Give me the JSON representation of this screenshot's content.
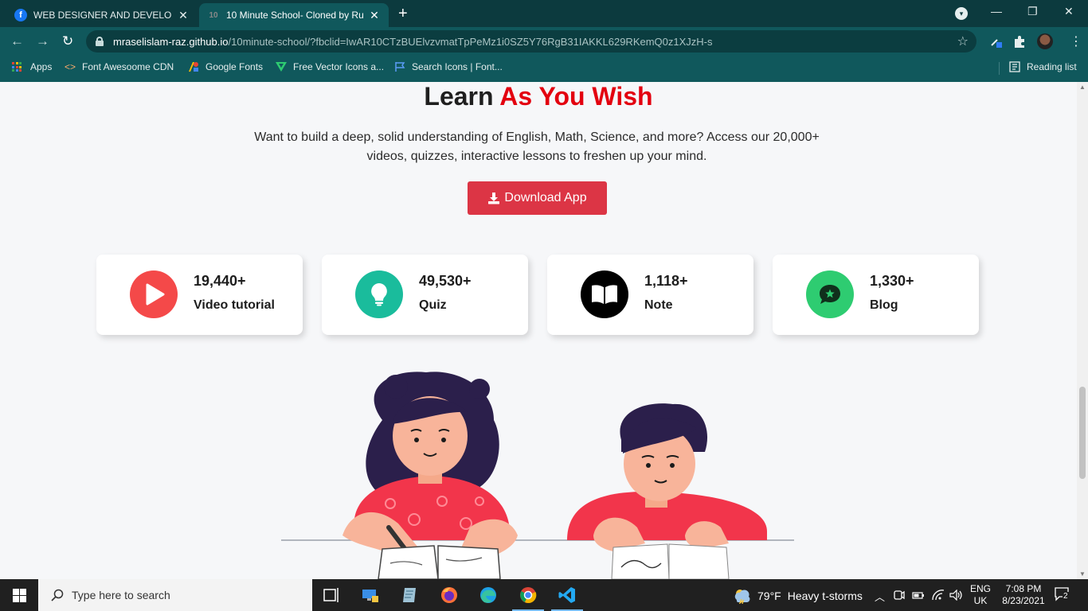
{
  "browser": {
    "tabs": [
      {
        "title": "WEB DESIGNER AND DEVELOPER",
        "favicon": "facebook-icon"
      },
      {
        "title": "10 Minute School- Cloned by Ru",
        "favicon": "10ms-icon"
      }
    ],
    "new_tab": "+",
    "address": {
      "host": "mraselislam-raz.github.io",
      "path": "/10minute-school/?fbclid=IwAR10CTzBUElvzvmatTpPeMz1i0SZ5Y76RgB31IAKKL629RKemQ0z1XJzH-s"
    },
    "bookmarks": [
      {
        "label": "Apps",
        "icon": "apps-grid-icon"
      },
      {
        "label": "Font Awesoome CDN",
        "icon": "code-brackets-icon"
      },
      {
        "label": "Google Fonts",
        "icon": "google-fonts-icon"
      },
      {
        "label": "Free Vector Icons a...",
        "icon": "vector-icon"
      },
      {
        "label": "Search Icons | Font...",
        "icon": "flag-icon"
      }
    ],
    "reading_list": "Reading list"
  },
  "hero": {
    "title_plain": "Learn",
    "title_accent": "As You Wish",
    "description": "Want to build a deep, solid understanding of English, Math, Science, and more? Access our 20,000+ videos, quizzes, interactive lessons to freshen up your mind.",
    "button_label": "Download App"
  },
  "stats": [
    {
      "count": "19,440+",
      "label": "Video tutorial",
      "icon": "play-icon",
      "color": "#f44949"
    },
    {
      "count": "49,530+",
      "label": "Quiz",
      "icon": "lightbulb-icon",
      "color": "#1abc9c"
    },
    {
      "count": "1,118+",
      "label": "Note",
      "icon": "book-open-icon",
      "color": "#000000"
    },
    {
      "count": "1,330+",
      "label": "Blog",
      "icon": "comment-star-icon",
      "color": "#2ecc71"
    }
  ],
  "colors": {
    "accent": "#e3000f",
    "button": "#dc3545",
    "chrome": "#10585c",
    "tabstrip": "#0c3a3e"
  },
  "taskbar": {
    "search_placeholder": "Type here to search",
    "weather_temp": "79°F",
    "weather_text": "Heavy t-storms",
    "lang_top": "ENG",
    "lang_bottom": "UK",
    "time": "7:08 PM",
    "date": "8/23/2021",
    "notification_count": "2"
  }
}
